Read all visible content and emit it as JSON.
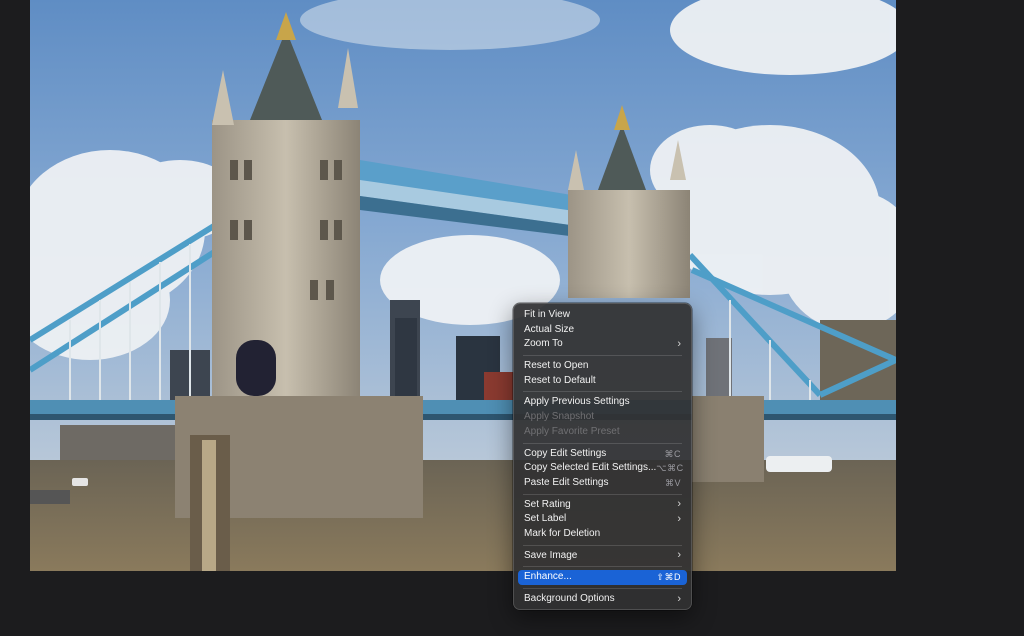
{
  "window": {
    "background": "#1c1c1e"
  },
  "photo": {
    "subject-icon": "tower-bridge-photo"
  },
  "context_menu": {
    "accent": "#1a63d6",
    "groups": [
      {
        "items": [
          {
            "label": "Fit in View",
            "shortcut": "",
            "submenu": false,
            "disabled": false
          },
          {
            "label": "Actual Size",
            "shortcut": "",
            "submenu": false,
            "disabled": false
          },
          {
            "label": "Zoom To",
            "shortcut": "",
            "submenu": true,
            "disabled": false
          }
        ]
      },
      {
        "items": [
          {
            "label": "Reset to Open",
            "shortcut": "",
            "submenu": false,
            "disabled": false
          },
          {
            "label": "Reset to Default",
            "shortcut": "",
            "submenu": false,
            "disabled": false
          }
        ]
      },
      {
        "items": [
          {
            "label": "Apply Previous Settings",
            "shortcut": "",
            "submenu": false,
            "disabled": false
          },
          {
            "label": "Apply Snapshot",
            "shortcut": "",
            "submenu": false,
            "disabled": true
          },
          {
            "label": "Apply Favorite Preset",
            "shortcut": "",
            "submenu": false,
            "disabled": true
          }
        ]
      },
      {
        "items": [
          {
            "label": "Copy Edit Settings",
            "shortcut": "⌘C",
            "submenu": false,
            "disabled": false
          },
          {
            "label": "Copy Selected Edit Settings...",
            "shortcut": "⌥⌘C",
            "submenu": false,
            "disabled": false
          },
          {
            "label": "Paste Edit Settings",
            "shortcut": "⌘V",
            "submenu": false,
            "disabled": false
          }
        ]
      },
      {
        "items": [
          {
            "label": "Set Rating",
            "shortcut": "",
            "submenu": true,
            "disabled": false
          },
          {
            "label": "Set Label",
            "shortcut": "",
            "submenu": true,
            "disabled": false
          },
          {
            "label": "Mark for Deletion",
            "shortcut": "",
            "submenu": false,
            "disabled": false
          }
        ]
      },
      {
        "items": [
          {
            "label": "Save Image",
            "shortcut": "",
            "submenu": true,
            "disabled": false
          }
        ]
      },
      {
        "items": [
          {
            "label": "Enhance...",
            "shortcut": "⇧⌘D",
            "submenu": false,
            "disabled": false,
            "selected": true
          }
        ]
      },
      {
        "items": [
          {
            "label": "Background Options",
            "shortcut": "",
            "submenu": true,
            "disabled": false
          }
        ]
      }
    ]
  }
}
